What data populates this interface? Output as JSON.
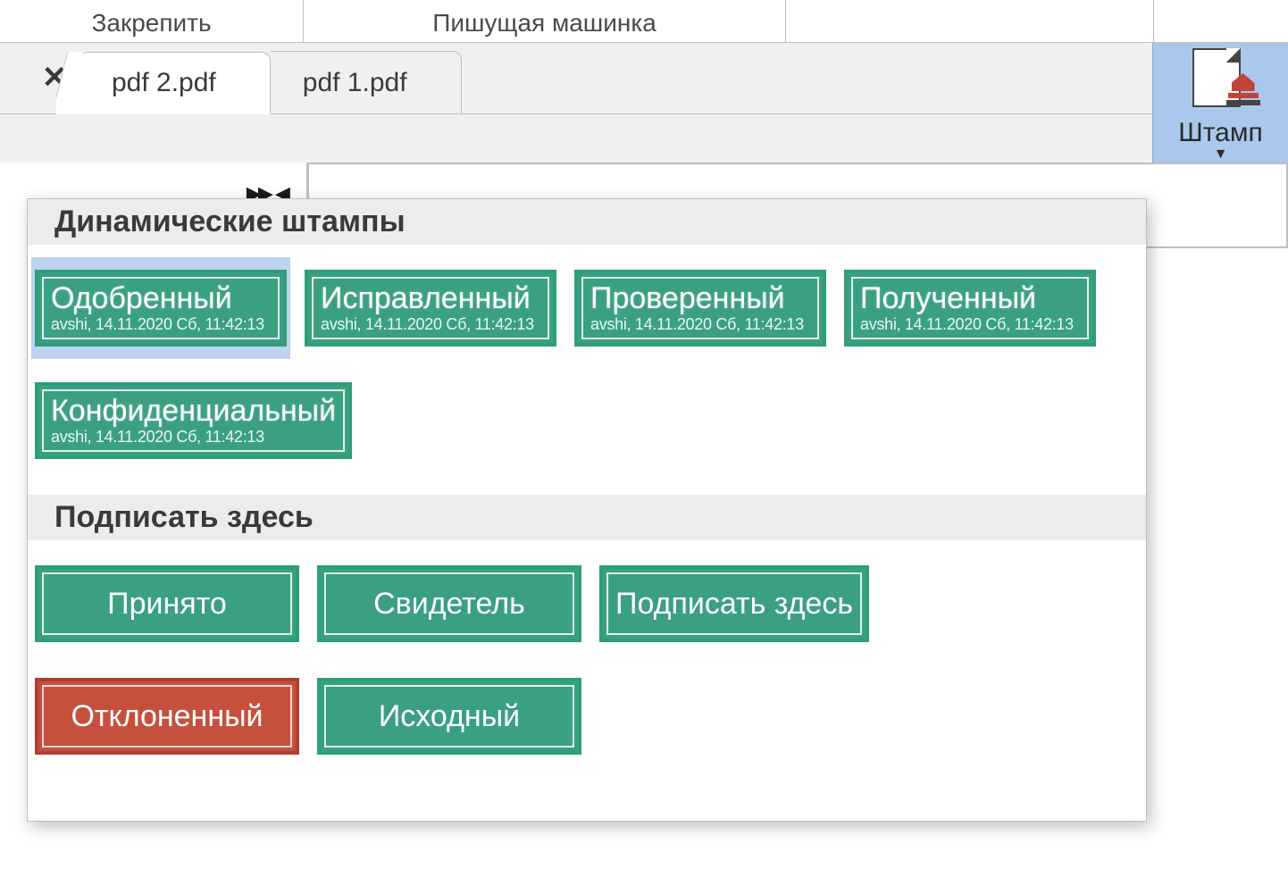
{
  "menubar": {
    "pin": "Закрепить",
    "typewriter": "Пишущая машинка"
  },
  "tabs": {
    "close_symbol": "✕",
    "tab1": "pdf 2.pdf",
    "tab2": "pdf 1.pdf"
  },
  "right_panel": {
    "label": "Штамп"
  },
  "sections": {
    "dynamic": "Динамические штампы",
    "sign_here": "Подписать здесь"
  },
  "stamp_meta": "avshi, 14.11.2020 Сб, 11:42:13",
  "dynamic_stamps": {
    "s1": "Одобренный",
    "s2": "Исправленный",
    "s3": "Проверенный",
    "s4": "Полученный",
    "s5": "Конфиденциальный"
  },
  "sign_stamps": {
    "s1": "Принято",
    "s2": "Свидетель",
    "s3": "Подписать здесь",
    "s4": "Отклоненный",
    "s5": "Исходный"
  }
}
